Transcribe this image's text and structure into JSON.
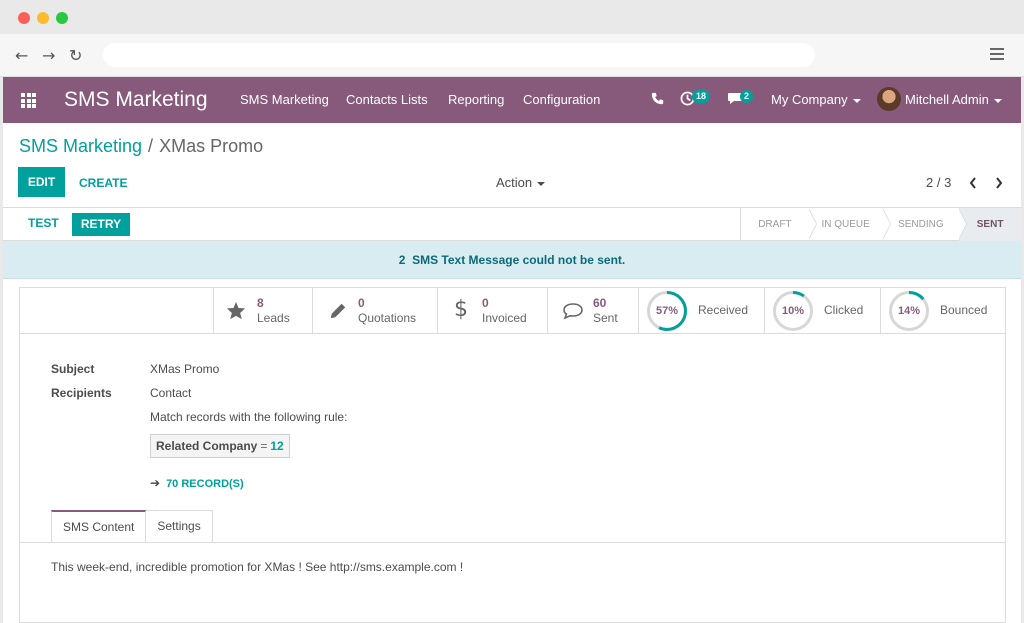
{
  "app": {
    "brand": "SMS Marketing",
    "menu": [
      "SMS Marketing",
      "Contacts Lists",
      "Reporting",
      "Configuration"
    ],
    "activity_count": "18",
    "message_count": "2",
    "company": "My Company",
    "user": "Mitchell Admin",
    "accent_color": "#875a7b",
    "primary_color": "#00a09d"
  },
  "breadcrumb": {
    "parent": "SMS Marketing",
    "separator": "/",
    "current": "XMas Promo"
  },
  "control_panel": {
    "edit_label": "EDIT",
    "create_label": "CREATE",
    "action_label": "Action",
    "pager": "2 / 3",
    "prev_icon": "chevron-left-icon",
    "next_icon": "chevron-right-icon"
  },
  "statusbar": {
    "test_label": "TEST",
    "retry_label": "RETRY",
    "stages": [
      "DRAFT",
      "IN QUEUE",
      "SENDING",
      "SENT"
    ],
    "current_stage": "SENT"
  },
  "alert": {
    "count": "2",
    "text": "SMS Text Message could not be sent."
  },
  "stats": {
    "leads": {
      "value": "8",
      "label": "Leads",
      "icon": "star-icon"
    },
    "quotations": {
      "value": "0",
      "label": "Quotations",
      "icon": "pencil-icon"
    },
    "invoiced": {
      "value": "0",
      "label": "Invoiced",
      "icon": "dollar-icon"
    },
    "sent": {
      "value": "60",
      "label": "Sent",
      "icon": "comment-icon"
    },
    "received": {
      "percent": 57,
      "text": "57%",
      "label": "Received"
    },
    "clicked": {
      "percent": 10,
      "text": "10%",
      "label": "Clicked"
    },
    "bounced": {
      "percent": 14,
      "text": "14%",
      "label": "Bounced"
    }
  },
  "form": {
    "subject_label": "Subject",
    "subject_value": "XMas Promo",
    "recipients_label": "Recipients",
    "recipients_value": "Contact",
    "rule_text": "Match records with the following rule:",
    "domain_field": "Related Company",
    "domain_operator": "=",
    "domain_value": "12",
    "records_link": "70 RECORD(S)"
  },
  "tabs": {
    "content_label": "SMS Content",
    "settings_label": "Settings",
    "active": "SMS Content"
  },
  "content": {
    "body": "This week-end, incredible promotion for XMas ! See http://sms.example.com !"
  }
}
